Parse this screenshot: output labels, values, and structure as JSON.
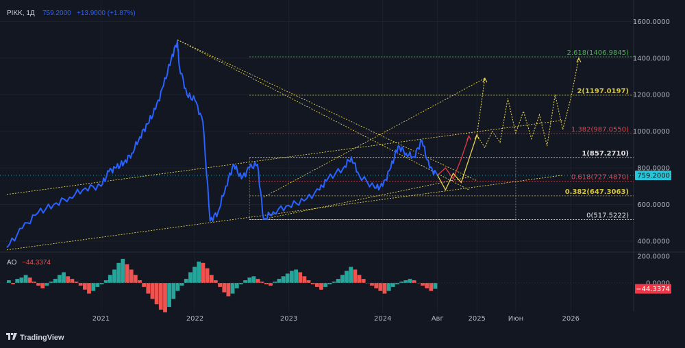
{
  "header": {
    "symbol": "PIKK, 1Д",
    "price": "759.2000",
    "change": "+13.9000 (+1.87%)"
  },
  "indicator": {
    "name": "AO",
    "value": "−44.3374",
    "badge": "−44.3374",
    "ticks": [
      "200.0000",
      "0.0000"
    ]
  },
  "watermark": "TradingView",
  "colors": {
    "price_line": "#2962ff",
    "fib_green": "#4caf50",
    "fib_yellow": "#d4c23a",
    "fib_red": "#e0464e",
    "fib_white": "#e0e0e0",
    "trend_yellow": "#e8d44d",
    "forecast_red": "#e63946",
    "ao_green": "#26a69a",
    "ao_red": "#ef5350",
    "price_badge": "#26c6da"
  },
  "chart_data": {
    "type": "line",
    "series": [
      {
        "values": [
          {
            "t": "2020-01",
            "y": 365
          },
          {
            "t": "2020-03",
            "y": 470
          },
          {
            "t": "2020-05",
            "y": 555
          },
          {
            "t": "2020-07",
            "y": 600
          },
          {
            "t": "2020-09",
            "y": 640
          },
          {
            "t": "2020-11",
            "y": 690
          },
          {
            "t": "2021-01",
            "y": 700
          },
          {
            "t": "2021-02",
            "y": 780
          },
          {
            "t": "2021-03",
            "y": 800
          },
          {
            "t": "2021-04",
            "y": 830
          },
          {
            "t": "2021-05",
            "y": 880
          },
          {
            "t": "2021-06",
            "y": 970
          },
          {
            "t": "2021-07",
            "y": 1040
          },
          {
            "t": "2021-08",
            "y": 1120
          },
          {
            "t": "2021-09",
            "y": 1250
          },
          {
            "t": "2021-10",
            "y": 1395
          },
          {
            "t": "2021-10-25",
            "y": 1495
          },
          {
            "t": "2021-11",
            "y": 1360
          },
          {
            "t": "2021-12",
            "y": 1200
          },
          {
            "t": "2022-01",
            "y": 1170
          },
          {
            "t": "2022-02",
            "y": 1050
          },
          {
            "t": "2022-03",
            "y": 510
          },
          {
            "t": "2022-04",
            "y": 560
          },
          {
            "t": "2022-05",
            "y": 700
          },
          {
            "t": "2022-06",
            "y": 820
          },
          {
            "t": "2022-07",
            "y": 740
          },
          {
            "t": "2022-08",
            "y": 800
          },
          {
            "t": "2022-09",
            "y": 820
          },
          {
            "t": "2022-09-25",
            "y": 520
          },
          {
            "t": "2022-11",
            "y": 560
          },
          {
            "t": "2023-01",
            "y": 595
          },
          {
            "t": "2023-03",
            "y": 620
          },
          {
            "t": "2023-05",
            "y": 680
          },
          {
            "t": "2023-06",
            "y": 740
          },
          {
            "t": "2023-08",
            "y": 800
          },
          {
            "t": "2023-09",
            "y": 860
          },
          {
            "t": "2023-10",
            "y": 760
          },
          {
            "t": "2023-12",
            "y": 690
          },
          {
            "t": "2024-01",
            "y": 700
          },
          {
            "t": "2024-02",
            "y": 800
          },
          {
            "t": "2024-03",
            "y": 920
          },
          {
            "t": "2024-04",
            "y": 880
          },
          {
            "t": "2024-05",
            "y": 860
          },
          {
            "t": "2024-06",
            "y": 950
          },
          {
            "t": "2024-07",
            "y": 800
          },
          {
            "t": "2024-08",
            "y": 760
          }
        ]
      }
    ],
    "price_axis": {
      "range": [
        340,
        1650
      ],
      "ticks": [
        "1600.0000",
        "1400.0000",
        "1200.0000",
        "1000.0000",
        "800.0000",
        "600.0000",
        "400.0000"
      ],
      "tick_values": [
        1600,
        1400,
        1200,
        1000,
        800,
        600,
        400
      ]
    },
    "time_axis": {
      "ticks": [
        {
          "label": "2021",
          "t": "2021-01"
        },
        {
          "label": "2022",
          "t": "2022-01"
        },
        {
          "label": "2023",
          "t": "2023-01"
        },
        {
          "label": "2024",
          "t": "2024-01"
        },
        {
          "label": "Авг",
          "t": "2024-08"
        },
        {
          "label": "2025",
          "t": "2025-01"
        },
        {
          "label": "Июн",
          "t": "2025-06"
        },
        {
          "label": "2026",
          "t": "2026-01"
        }
      ]
    },
    "fib_levels": [
      {
        "label": "2.618(1406.9845)",
        "value": 1406.9845,
        "color": "#4caf50",
        "bold": false
      },
      {
        "label": "2(1197.0197)",
        "value": 1197.0197,
        "color": "#d4c23a",
        "bold": true
      },
      {
        "label": "1.382(987.0550)",
        "value": 987.055,
        "color": "#e0464e",
        "bold": false
      },
      {
        "label": "1(857.2710)",
        "value": 857.271,
        "color": "#e0e0e0",
        "bold": true
      },
      {
        "label": "0.618(727.4870)",
        "value": 727.487,
        "color": "#e0464e",
        "bold": false
      },
      {
        "label": "0.382(647.3063)",
        "value": 647.3063,
        "color": "#d4c23a",
        "bold": true
      },
      {
        "label": "0(517.5222)",
        "value": 517.5222,
        "color": "#e0e0e0",
        "bold": false
      }
    ],
    "current_price": {
      "label": "759.2000",
      "value": 759.2
    },
    "forecast_red": [
      {
        "t": "2024-08",
        "y": 760
      },
      {
        "t": "2024-09",
        "y": 800
      },
      {
        "t": "2024-10",
        "y": 740
      },
      {
        "t": "2024-11",
        "y": 850
      },
      {
        "t": "2024-12",
        "y": 975
      }
    ],
    "forecast_yellow_solid": [
      {
        "t": "2024-08",
        "y": 760
      },
      {
        "t": "2024-09",
        "y": 680
      },
      {
        "t": "2024-10",
        "y": 770
      },
      {
        "t": "2024-11",
        "y": 720
      },
      {
        "t": "2025-01",
        "y": 980
      }
    ],
    "forecast_yellow_dotted": [
      {
        "t": "2025-01",
        "y": 980
      },
      {
        "t": "2025-02",
        "y": 1290
      }
    ],
    "forecast_yellow_dotted_2": [
      {
        "t": "2025-01",
        "y": 980
      },
      {
        "t": "2025-02",
        "y": 910
      },
      {
        "t": "2025-03",
        "y": 1000
      },
      {
        "t": "2025-04",
        "y": 940
      },
      {
        "t": "2025-05",
        "y": 1180
      },
      {
        "t": "2025-06",
        "y": 990
      },
      {
        "t": "2025-07",
        "y": 1110
      },
      {
        "t": "2025-08",
        "y": 960
      },
      {
        "t": "2025-09",
        "y": 1090
      },
      {
        "t": "2025-10",
        "y": 920
      },
      {
        "t": "2025-11",
        "y": 1200
      },
      {
        "t": "2025-12",
        "y": 1010
      },
      {
        "t": "2026-01",
        "y": 1180
      },
      {
        "t": "2026-02",
        "y": 1400
      }
    ],
    "ao_histogram": [
      20,
      -10,
      30,
      40,
      60,
      40,
      10,
      -20,
      -40,
      -20,
      10,
      30,
      60,
      80,
      50,
      30,
      10,
      -20,
      -50,
      -80,
      -60,
      -30,
      -10,
      20,
      60,
      100,
      150,
      180,
      140,
      100,
      60,
      20,
      -30,
      -80,
      -120,
      -160,
      -200,
      -220,
      -180,
      -120,
      -60,
      -20,
      30,
      80,
      120,
      160,
      150,
      110,
      60,
      20,
      -30,
      -70,
      -100,
      -80,
      -40,
      -10,
      20,
      40,
      50,
      30,
      10,
      -10,
      -20,
      10,
      30,
      50,
      70,
      90,
      100,
      80,
      50,
      20,
      -10,
      -30,
      -50,
      -30,
      -10,
      10,
      30,
      60,
      90,
      120,
      100,
      60,
      30,
      0,
      -20,
      -40,
      -60,
      -80,
      -60,
      -30,
      -10,
      10,
      20,
      30,
      20,
      0,
      -20,
      -40,
      -60,
      -44
    ]
  }
}
